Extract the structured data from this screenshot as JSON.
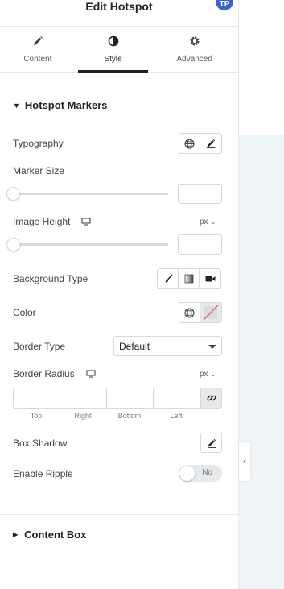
{
  "header": {
    "title": "Edit Hotspot",
    "avatar_initials": "TP"
  },
  "tabs": [
    {
      "label": "Content",
      "icon": "pencil-icon"
    },
    {
      "label": "Style",
      "icon": "contrast-icon"
    },
    {
      "label": "Advanced",
      "icon": "gear-icon"
    }
  ],
  "active_tab": "Style",
  "section": {
    "title": "Hotspot Markers",
    "typography_label": "Typography",
    "marker_size_label": "Marker Size",
    "image_height_label": "Image Height",
    "image_height_unit": "px",
    "background_type_label": "Background Type",
    "color_label": "Color",
    "border_type_label": "Border Type",
    "border_type_value": "Default",
    "border_radius_label": "Border Radius",
    "border_radius_unit": "px",
    "dims": [
      "Top",
      "Right",
      "Bottom",
      "Left"
    ],
    "box_shadow_label": "Box Shadow",
    "enable_ripple_label": "Enable Ripple",
    "enable_ripple_value": "No"
  },
  "section2": {
    "title": "Content Box"
  },
  "colors": {
    "accent": "#1f2124",
    "avatar": "#3a65c7",
    "canvas": "#eef3f6"
  }
}
